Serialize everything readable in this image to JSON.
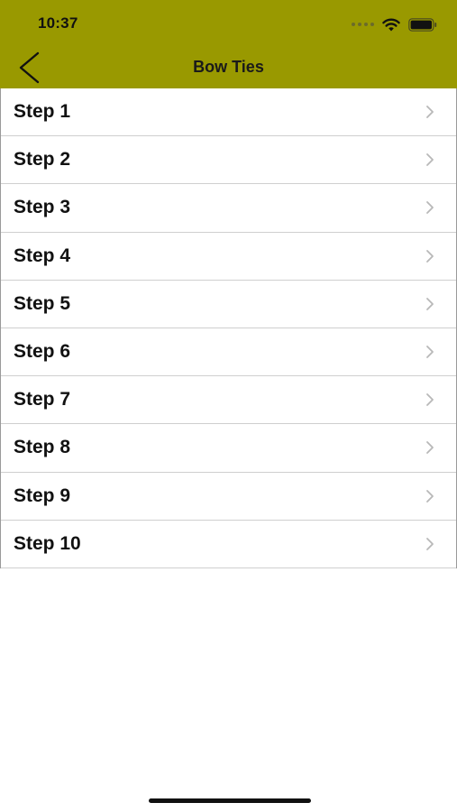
{
  "status_bar": {
    "time": "10:37",
    "icons": [
      "signal-dots-icon",
      "wifi-icon",
      "battery-icon"
    ]
  },
  "nav_bar": {
    "title": "Bow Ties",
    "back_icon": "chevron-left-icon",
    "background_color": "#999900"
  },
  "steps": [
    {
      "label": "Step 1"
    },
    {
      "label": "Step 2"
    },
    {
      "label": "Step 3"
    },
    {
      "label": "Step 4"
    },
    {
      "label": "Step 5"
    },
    {
      "label": "Step 6"
    },
    {
      "label": "Step 7"
    },
    {
      "label": "Step 8"
    },
    {
      "label": "Step 9"
    },
    {
      "label": "Step 10"
    }
  ],
  "row_disclosure_icon": "chevron-right-icon",
  "colors": {
    "text": "#111111",
    "separator": "#cfcfcf",
    "chevron": "#b8b8b8"
  }
}
